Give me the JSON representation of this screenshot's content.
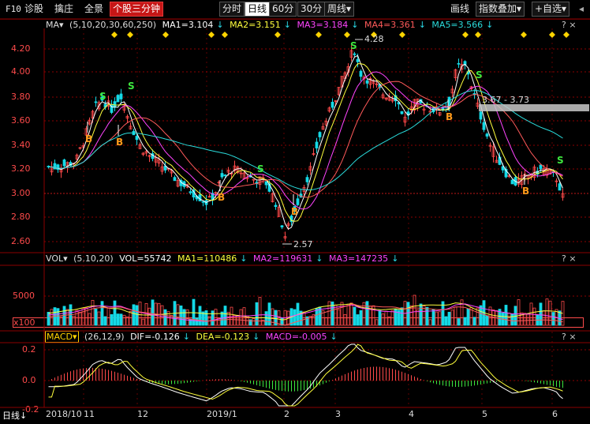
{
  "toolbar": {
    "f10": "F10",
    "zhengu": "诊股",
    "niuzhuang": "擒庄",
    "quanjing": "全景",
    "stock_select": "个股三分钟",
    "periods": [
      "分时",
      "日线",
      "60分",
      "30分",
      "周线▾"
    ],
    "period_active_index": 1,
    "draw": "画线",
    "overlay": "指数叠加▾",
    "self_select": "+自选▾"
  },
  "main_legend": {
    "ma_menu": "MA▾",
    "params": "(5,10,20,30,60,250)",
    "ma1": "MA1=3.104",
    "ma2": "MA2=3.151",
    "ma3": "MA3=3.184",
    "ma4": "MA4=3.361",
    "ma5": "MA5=3.566"
  },
  "vol_legend": {
    "menu": "VOL▾",
    "params": "(5,10,20)",
    "vol": "VOL=55742",
    "ma1": "MA1=110486",
    "ma2": "MA2=119631",
    "ma3": "MA3=147235"
  },
  "macd_legend": {
    "menu": "MACD▾",
    "params": "(26,12,9)",
    "dif": "DIF=-0.126",
    "dea": "DEA=-0.123",
    "macd": "MACD=-0.005"
  },
  "price_axis": [
    "4.20",
    "4.00",
    "3.80",
    "3.60",
    "3.40",
    "3.20",
    "3.00",
    "2.80",
    "2.60"
  ],
  "vol_axis": [
    "5000",
    "x100"
  ],
  "macd_axis": [
    "0.2",
    "0.0",
    "-0.2"
  ],
  "x_axis": {
    "period_label": "日线",
    "labels": [
      "2018/10",
      "11",
      "12",
      "2019/1",
      "2",
      "3",
      "4",
      "5",
      "6"
    ]
  },
  "annotations": {
    "high": "4.28",
    "low": "2.57",
    "range": "3.67 - 3.73"
  },
  "signals": {
    "buy": "B",
    "sell": "S"
  },
  "colors": {
    "up": "#ff4a4a",
    "down": "#14d9e6",
    "ma1": "#ffffff",
    "ma2": "#ffff3c",
    "ma3": "#ff44ff",
    "ma4": "#ff5a5a",
    "ma5": "#2adcdc",
    "grid": "#8b0000",
    "diamond": "#ffd400"
  }
}
